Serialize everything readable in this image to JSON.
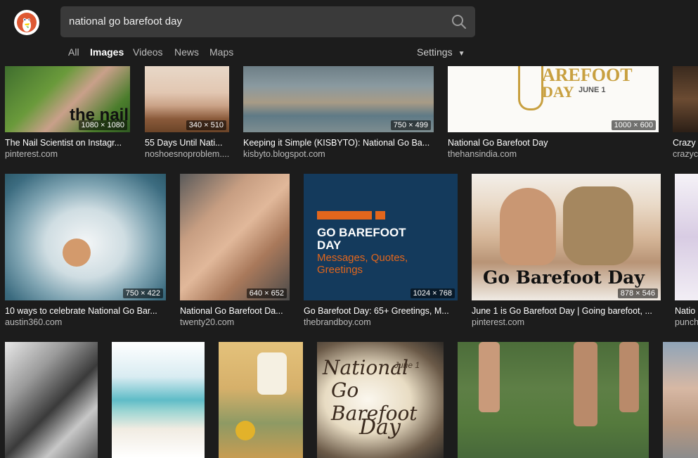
{
  "search": {
    "query": "national go barefoot day"
  },
  "nav": {
    "all": "All",
    "images": "Images",
    "videos": "Videos",
    "news": "News",
    "maps": "Maps",
    "settings": "Settings"
  },
  "icons": {
    "logo": "duckduckgo-logo",
    "search": "search-icon",
    "caret": "caret-down-icon"
  },
  "colors": {
    "background": "#1c1c1c",
    "search_bg": "#3a3a3a",
    "brandboy_bg": "#143a5c",
    "brandboy_orange": "#e2661c"
  },
  "results": [
    {
      "dims": "1080 × 1080",
      "title": "The Nail Scientist on Instagr...",
      "source": "pinterest.com",
      "overlay": "the nail"
    },
    {
      "dims": "340 × 510",
      "title": "55 Days Until Nati...",
      "source": "noshoesnoproblem...."
    },
    {
      "dims": "750 × 499",
      "title": "Keeping it Simple (KISBYTO): National Go Ba...",
      "source": "kisbyto.blogspot.com"
    },
    {
      "dims": "1000 × 600",
      "title": "National Go Barefoot Day",
      "source": "thehansindia.com",
      "overlay": "AREFOOT",
      "overlay2": "DAY",
      "overlay3": "JUNE 1"
    },
    {
      "dims": "",
      "title": "Crazy",
      "source": "crazyc"
    },
    {
      "dims": "750 × 422",
      "title": "10 ways to celebrate National Go Bar...",
      "source": "austin360.com"
    },
    {
      "dims": "640 × 652",
      "title": "National Go Barefoot Da...",
      "source": "twenty20.com"
    },
    {
      "dims": "1024 × 768",
      "title": "Go Barefoot Day: 65+ Greetings, M...",
      "source": "thebrandboy.com",
      "overlay": "GO BAREFOOT",
      "overlay2": "DAY",
      "overlay3": "Messages, Quotes,",
      "overlay4": "Greetings"
    },
    {
      "dims": "878 × 546",
      "title": "June 1 is Go Barefoot Day | Going barefoot, ...",
      "source": "pinterest.com",
      "overlay": "Go Barefoot Day"
    },
    {
      "dims": "",
      "title": "Natio",
      "source": "punch"
    },
    {
      "overlay": "June 1",
      "overlay2": "National",
      "overlay3": "Go Barefoot",
      "overlay4": "Day"
    }
  ]
}
